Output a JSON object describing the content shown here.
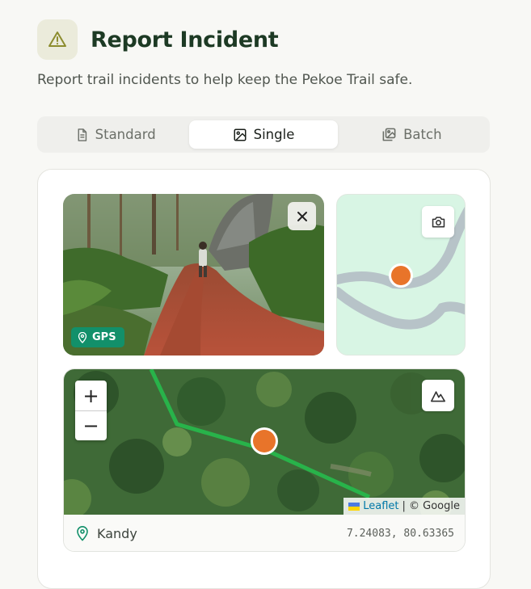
{
  "header": {
    "title": "Report Incident",
    "subtitle": "Report trail incidents to help keep the Pekoe Trail safe.",
    "icon": "warning-triangle-icon"
  },
  "tabs": [
    {
      "label": "Standard",
      "icon": "document-icon",
      "active": false
    },
    {
      "label": "Single",
      "icon": "image-icon",
      "active": true
    },
    {
      "label": "Batch",
      "icon": "images-stack-icon",
      "active": false
    }
  ],
  "photo": {
    "badge_label": "GPS",
    "close_icon": "close-icon"
  },
  "minimap": {
    "button_icon": "camera-icon",
    "marker_color": "#e8742a"
  },
  "map": {
    "zoom_in_label": "+",
    "zoom_out_label": "−",
    "layer_button_icon": "mountain-icon",
    "attribution_link": "Leaflet",
    "attribution_text": "| © Google",
    "trail_color": "#28b34a",
    "marker_color": "#e8742a"
  },
  "location": {
    "name": "Kandy",
    "coords": "7.24083, 80.63365"
  },
  "colors": {
    "accent": "#12906a",
    "title": "#1d3a24"
  }
}
